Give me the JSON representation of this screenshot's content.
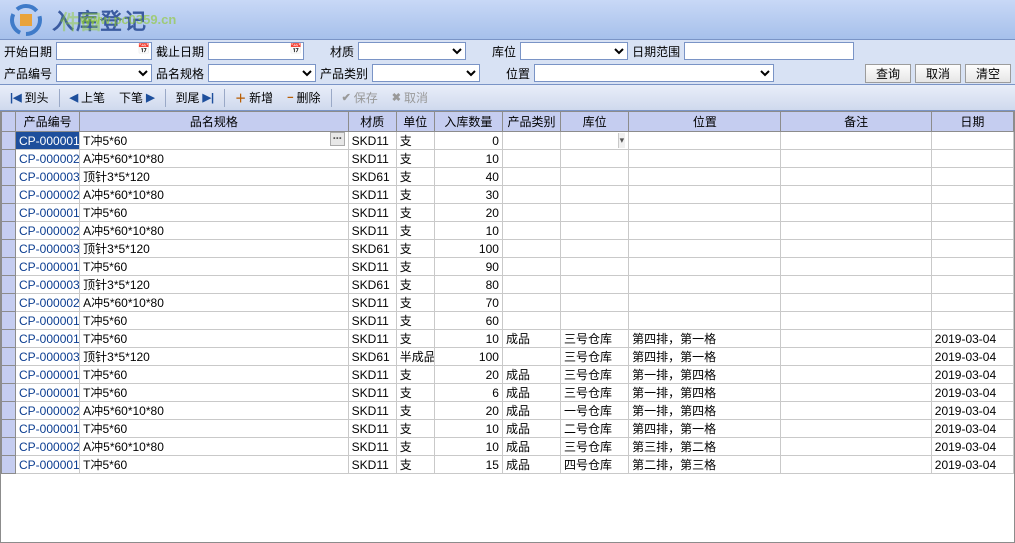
{
  "title": "入库登记",
  "watermark_site": "www.pc0359.cn",
  "watermark_text": "件园",
  "filters": {
    "row1": {
      "start_date_label": "开始日期",
      "end_date_label": "截止日期",
      "material_label": "材质",
      "warehouse_label": "库位",
      "date_range_label": "日期范围"
    },
    "row2": {
      "product_code_label": "产品编号",
      "spec_label": "品名规格",
      "category_label": "产品类别",
      "position_label": "位置",
      "query_btn": "查询",
      "cancel_btn": "取消",
      "clear_btn": "清空"
    }
  },
  "toolbar": {
    "first": "到头",
    "prev": "上笔",
    "next": "下笔",
    "last": "到尾",
    "add": "新增",
    "delete": "删除",
    "save": "保存",
    "cancel": "取消"
  },
  "grid": {
    "headers": {
      "code": "产品编号",
      "spec": "品名规格",
      "material": "材质",
      "unit": "单位",
      "qty": "入库数量",
      "category": "产品类别",
      "warehouse": "库位",
      "position": "位置",
      "note": "备注",
      "date": "日期"
    },
    "rows": [
      {
        "code": "CP-000001",
        "spec": "T冲5*60",
        "material": "SKD11",
        "unit": "支",
        "qty": 0,
        "category": "",
        "warehouse": "",
        "position": "",
        "note": "",
        "date": "",
        "selected": true,
        "dropdown": true
      },
      {
        "code": "CP-000002",
        "spec": "A冲5*60*10*80",
        "material": "SKD11",
        "unit": "支",
        "qty": 10,
        "category": "",
        "warehouse": "",
        "position": "",
        "note": "",
        "date": ""
      },
      {
        "code": "CP-000003",
        "spec": "顶针3*5*120",
        "material": "SKD61",
        "unit": "支",
        "qty": 40,
        "category": "",
        "warehouse": "",
        "position": "",
        "note": "",
        "date": ""
      },
      {
        "code": "CP-000002",
        "spec": "A冲5*60*10*80",
        "material": "SKD11",
        "unit": "支",
        "qty": 30,
        "category": "",
        "warehouse": "",
        "position": "",
        "note": "",
        "date": ""
      },
      {
        "code": "CP-000001",
        "spec": "T冲5*60",
        "material": "SKD11",
        "unit": "支",
        "qty": 20,
        "category": "",
        "warehouse": "",
        "position": "",
        "note": "",
        "date": ""
      },
      {
        "code": "CP-000002",
        "spec": "A冲5*60*10*80",
        "material": "SKD11",
        "unit": "支",
        "qty": 10,
        "category": "",
        "warehouse": "",
        "position": "",
        "note": "",
        "date": ""
      },
      {
        "code": "CP-000003",
        "spec": "顶针3*5*120",
        "material": "SKD61",
        "unit": "支",
        "qty": 100,
        "category": "",
        "warehouse": "",
        "position": "",
        "note": "",
        "date": ""
      },
      {
        "code": "CP-000001",
        "spec": "T冲5*60",
        "material": "SKD11",
        "unit": "支",
        "qty": 90,
        "category": "",
        "warehouse": "",
        "position": "",
        "note": "",
        "date": ""
      },
      {
        "code": "CP-000003",
        "spec": "顶针3*5*120",
        "material": "SKD61",
        "unit": "支",
        "qty": 80,
        "category": "",
        "warehouse": "",
        "position": "",
        "note": "",
        "date": ""
      },
      {
        "code": "CP-000002",
        "spec": "A冲5*60*10*80",
        "material": "SKD11",
        "unit": "支",
        "qty": 70,
        "category": "",
        "warehouse": "",
        "position": "",
        "note": "",
        "date": ""
      },
      {
        "code": "CP-000001",
        "spec": "T冲5*60",
        "material": "SKD11",
        "unit": "支",
        "qty": 60,
        "category": "",
        "warehouse": "",
        "position": "",
        "note": "",
        "date": ""
      },
      {
        "code": "CP-000001",
        "spec": "T冲5*60",
        "material": "SKD11",
        "unit": "支",
        "qty": 10,
        "category": "成品",
        "warehouse": "三号仓库",
        "position": "第四排，第一格",
        "note": "",
        "date": "2019-03-04"
      },
      {
        "code": "CP-000003",
        "spec": "顶针3*5*120",
        "material": "SKD61",
        "unit": "半成品",
        "qty": 100,
        "category": "",
        "warehouse": "三号仓库",
        "position": "第四排，第一格",
        "note": "",
        "date": "2019-03-04"
      },
      {
        "code": "CP-000001",
        "spec": "T冲5*60",
        "material": "SKD11",
        "unit": "支",
        "qty": 20,
        "category": "成品",
        "warehouse": "三号仓库",
        "position": "第一排，第四格",
        "note": "",
        "date": "2019-03-04"
      },
      {
        "code": "CP-000001",
        "spec": "T冲5*60",
        "material": "SKD11",
        "unit": "支",
        "qty": 6,
        "category": "成品",
        "warehouse": "三号仓库",
        "position": "第一排，第四格",
        "note": "",
        "date": "2019-03-04"
      },
      {
        "code": "CP-000002",
        "spec": "A冲5*60*10*80",
        "material": "SKD11",
        "unit": "支",
        "qty": 20,
        "category": "成品",
        "warehouse": "一号仓库",
        "position": "第一排，第四格",
        "note": "",
        "date": "2019-03-04"
      },
      {
        "code": "CP-000001",
        "spec": "T冲5*60",
        "material": "SKD11",
        "unit": "支",
        "qty": 10,
        "category": "成品",
        "warehouse": "二号仓库",
        "position": "第四排，第一格",
        "note": "",
        "date": "2019-03-04"
      },
      {
        "code": "CP-000002",
        "spec": "A冲5*60*10*80",
        "material": "SKD11",
        "unit": "支",
        "qty": 10,
        "category": "成品",
        "warehouse": "三号仓库",
        "position": "第三排，第二格",
        "note": "",
        "date": "2019-03-04"
      },
      {
        "code": "CP-000001",
        "spec": "T冲5*60",
        "material": "SKD11",
        "unit": "支",
        "qty": 15,
        "category": "成品",
        "warehouse": "四号仓库",
        "position": "第二排，第三格",
        "note": "",
        "date": "2019-03-04"
      }
    ]
  }
}
